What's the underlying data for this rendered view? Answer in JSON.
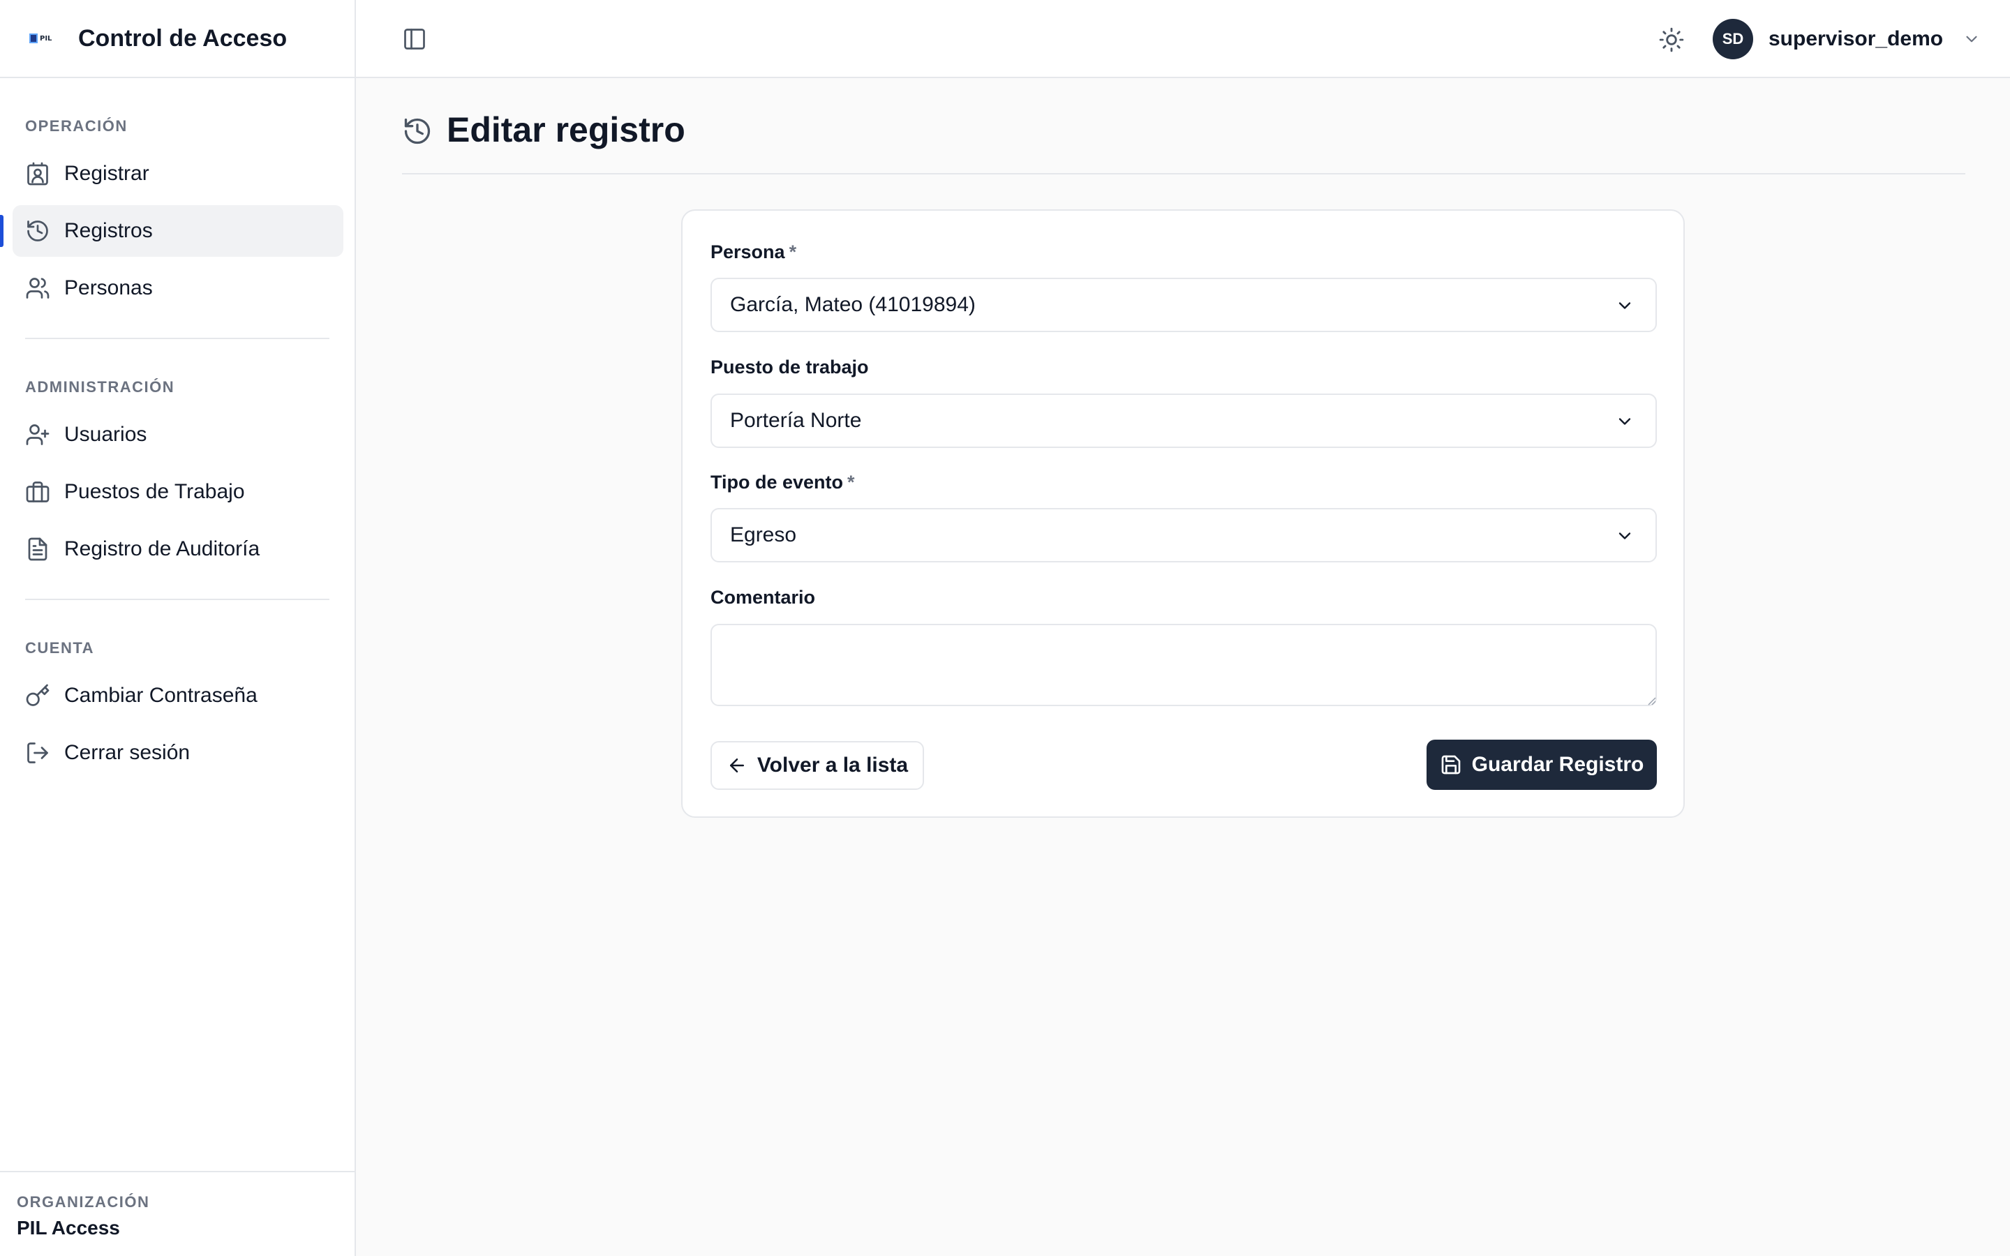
{
  "app": {
    "title": "Control de Acceso",
    "logo_text": "PIL"
  },
  "sidebar": {
    "sections": [
      {
        "label": "OPERACIÓN",
        "items": [
          {
            "label": "Registrar",
            "icon": "contact-icon"
          },
          {
            "label": "Registros",
            "icon": "history-icon",
            "active": true
          },
          {
            "label": "Personas",
            "icon": "users-icon"
          }
        ]
      },
      {
        "label": "ADMINISTRACIÓN",
        "items": [
          {
            "label": "Usuarios",
            "icon": "user-plus-icon"
          },
          {
            "label": "Puestos de Trabajo",
            "icon": "briefcase-icon"
          },
          {
            "label": "Registro de Auditoría",
            "icon": "file-text-icon"
          }
        ]
      },
      {
        "label": "CUENTA",
        "items": [
          {
            "label": "Cambiar Contraseña",
            "icon": "key-icon"
          },
          {
            "label": "Cerrar sesión",
            "icon": "logout-icon"
          }
        ]
      }
    ],
    "footer": {
      "label": "ORGANIZACIÓN",
      "name": "PIL Access"
    }
  },
  "topbar": {
    "avatar_initials": "SD",
    "username": "supervisor_demo"
  },
  "page": {
    "title": "Editar registro"
  },
  "form": {
    "persona": {
      "label": "Persona",
      "required_mark": "*",
      "value": "García, Mateo (41019894)"
    },
    "puesto": {
      "label": "Puesto de trabajo",
      "value": "Portería Norte"
    },
    "tipo": {
      "label": "Tipo de evento",
      "required_mark": "*",
      "value": "Egreso"
    },
    "comentario": {
      "label": "Comentario",
      "value": ""
    },
    "back_label": "Volver a la lista",
    "save_label": "Guardar Registro"
  },
  "colors": {
    "accent": "#1d4ed8",
    "primary_button": "#1e293b",
    "background": "#fafafa"
  }
}
